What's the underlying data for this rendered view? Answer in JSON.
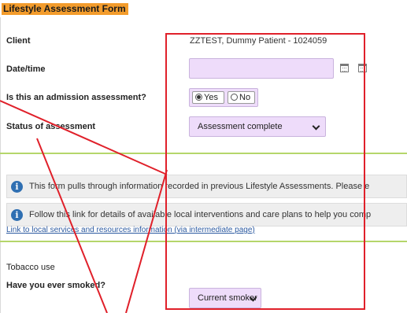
{
  "form": {
    "title": "Lifestyle Assessment Form"
  },
  "fields": {
    "client_label": "Client",
    "client_value": "ZZTEST, Dummy Patient - 1024059",
    "datetime_label": "Date/time",
    "datetime_value": "",
    "admission_label": "Is this an admission assessment?",
    "admission_yes": "Yes",
    "admission_no": "No",
    "admission_selected": "Yes",
    "status_label": "Status of assessment",
    "status_value": "Assessment complete"
  },
  "info": {
    "pulls_text": "This form pulls through information recorded in previous Lifestyle Assessments. Please e",
    "follow_text": "Follow this link for details of available local interventions and care plans to help you comp"
  },
  "link": {
    "text": "Link to local services and resources information (via intermediate page)"
  },
  "tobacco": {
    "section_title": "Tobacco use",
    "smoked_label": "Have you ever smoked?",
    "smoked_value": "Current smoker"
  },
  "colors": {
    "title_bg": "#f39c2c",
    "field_bg": "#eedcfa",
    "green_divider": "#b5d66b",
    "annotation_red": "#e0202a",
    "info_icon": "#2f6fb2",
    "link": "#2c5aa0"
  },
  "icons": [
    "calendar-icon",
    "info-icon",
    "chevron-down-icon"
  ]
}
